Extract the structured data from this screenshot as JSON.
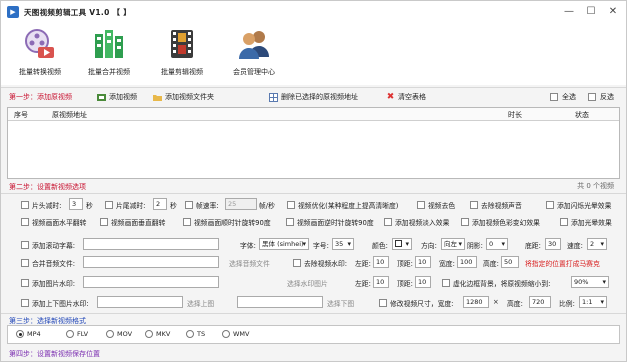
{
  "titlebar": {
    "title": "天图视频剪辑工具 V1.0 【                     】",
    "min": "—",
    "max": "☐",
    "close": "✕"
  },
  "toolbar": [
    {
      "label": "批量转换视频",
      "icon": "film-convert-icon"
    },
    {
      "label": "批量合并视频",
      "icon": "merge-blocks-icon"
    },
    {
      "label": "批量剪辑视频",
      "icon": "film-cut-icon"
    },
    {
      "label": "会员管理中心",
      "icon": "users-icon"
    }
  ],
  "step1": {
    "title": "第一步：添加原视频",
    "add_video": "添加视频",
    "add_folder": "添加视频文件夹",
    "delete_selected": "删除已选择的原视频地址",
    "clear_table": "清空表格",
    "select_all": "全选",
    "invert": "反选"
  },
  "grid": {
    "col_index": "序号",
    "col_path": "原视频地址",
    "col_duration": "时长",
    "col_status": "状态",
    "count": "共 0 个视频"
  },
  "step2": {
    "title": "第二步：设置新视频选项",
    "r1": {
      "cut_head": "片头减时:",
      "cut_head_val": "3",
      "sec1": "秒",
      "cut_tail": "片尾减时:",
      "cut_tail_val": "2",
      "sec2": "秒",
      "fps": "帧速率:",
      "fps_val": "25",
      "fps_unit": "帧/秒",
      "optimize": "视频优化(某种程度上提高清晰度)",
      "decolor": "视频去色",
      "remove_audio": "去除视频声音",
      "flash": "添加闪烁光晕效果"
    },
    "r2": {
      "hflip": "视频画面水平翻转",
      "vflip": "视频画面垂直翻转",
      "rot_cw": "视频画面顺时针旋转90度",
      "rot_ccw": "视频画面逆时针旋转90度",
      "fade_in": "添加视频淡入效果",
      "color_change": "添加视频色彩变幻效果",
      "glow": "添加光晕效果"
    },
    "r3": {
      "subtitle": "添加滚动字幕:",
      "font": "字体:",
      "font_val": "黑体 (simhei)",
      "size": "字号:",
      "size_val": "35",
      "color": "颜色:",
      "dir": "方向:",
      "dir_val": "向左",
      "shadow": "阴影:",
      "shadow_val": "0",
      "bottom": "底距:",
      "bottom_val": "30",
      "speed": "速度:",
      "speed_val": "2"
    },
    "r4": {
      "bgm": "合并音频文件:",
      "pick_audio": "选择音频文件",
      "rm_watermark": "去除视频水印:",
      "left": "左距:",
      "left_val": "10",
      "top": "顶距:",
      "top_val": "10",
      "width": "宽度:",
      "width_val": "100",
      "height": "高度:",
      "height_val": "50",
      "hint": "将指定的位置打成马赛克"
    },
    "r5": {
      "img_watermark": "添加图片水印:",
      "pick_wm": "选择水印图片",
      "left": "左距:",
      "left_val": "10",
      "top": "顶距:",
      "top_val": "10",
      "blur_bg": "虚化边框背景，将原视频缩小到:",
      "blur_val": "90%"
    },
    "r6": {
      "tb_wm": "添加上下图片水印:",
      "pick_top": "选择上图",
      "pick_bottom": "选择下图",
      "resize": "修改视频尺寸，宽度:",
      "w_val": "1280",
      "x": "×",
      "h_label": "高度:",
      "h_val": "720",
      "ratio": "比例:",
      "ratio_val": "1:1"
    }
  },
  "step3": {
    "title": "第三步：选择新视频格式",
    "formats": [
      "MP4",
      "FLV",
      "MOV",
      "MKV",
      "TS",
      "WMV"
    ],
    "selected": "MP4"
  },
  "step4": {
    "title": "第四步：设置新视频保存位置"
  }
}
